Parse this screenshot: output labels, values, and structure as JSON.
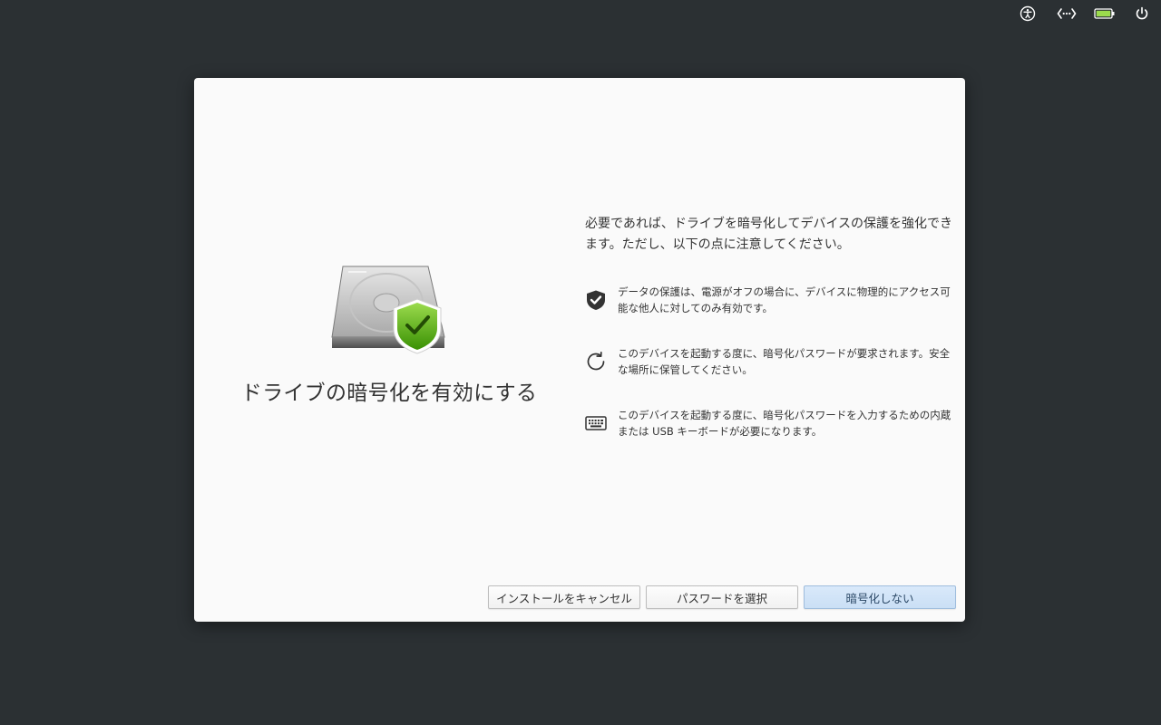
{
  "colors": {
    "desktop_background": "#2b3033",
    "window_background": "#fafafa",
    "battery_fill": "#9bdb4d",
    "shield_green": "#68b723",
    "suggested_button": "#cadff5"
  },
  "topbar": {
    "icons": [
      "accessibility-icon",
      "network-icon",
      "battery-icon",
      "power-icon"
    ]
  },
  "dialog": {
    "hero_icon": "drive-harddisk-encrypted-icon",
    "title": "ドライブの暗号化を有効にする",
    "intro": "必要であれば、ドライブを暗号化してデバイスの保護を強化できます。ただし、以下の点に注意してください。",
    "items": [
      {
        "icon": "shield-check-icon",
        "text": "データの保護は、電源がオフの場合に、デバイスに物理的にアクセス可能な他人に対してのみ有効です。"
      },
      {
        "icon": "refresh-icon",
        "text": "このデバイスを起動する度に、暗号化パスワードが要求されます。安全な場所に保管してください。"
      },
      {
        "icon": "keyboard-icon",
        "text": "このデバイスを起動する度に、暗号化パスワードを入力するための内蔵または USB キーボードが必要になります。"
      }
    ],
    "buttons": {
      "cancel_install": "インストールをキャンセル",
      "choose_password": "パスワードを選択",
      "no_encryption": "暗号化しない"
    }
  }
}
